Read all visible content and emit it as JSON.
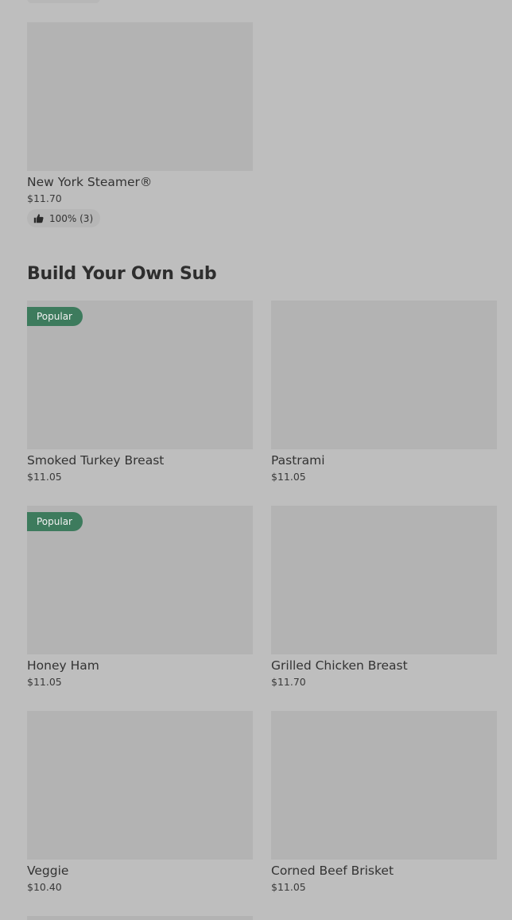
{
  "featured": {
    "name": "New York Steamer®",
    "price": "$11.70",
    "rating": "100% (3)"
  },
  "section": {
    "title": "Build Your Own Sub",
    "items": [
      {
        "name": "Smoked Turkey Breast",
        "price": "$11.05",
        "badge": "Popular"
      },
      {
        "name": "Pastrami",
        "price": "$11.05"
      },
      {
        "name": "Honey Ham",
        "price": "$11.05",
        "badge": "Popular"
      },
      {
        "name": "Grilled Chicken Breast",
        "price": "$11.70"
      },
      {
        "name": "Veggie",
        "price": "$10.40"
      },
      {
        "name": "Corned Beef Brisket",
        "price": "$11.05"
      }
    ]
  },
  "icons": {
    "rating": "thumbs-up-icon"
  },
  "colors": {
    "background": "#bebebe",
    "image_placeholder": "#b3b3b3",
    "badge": "#3d7b5d"
  }
}
